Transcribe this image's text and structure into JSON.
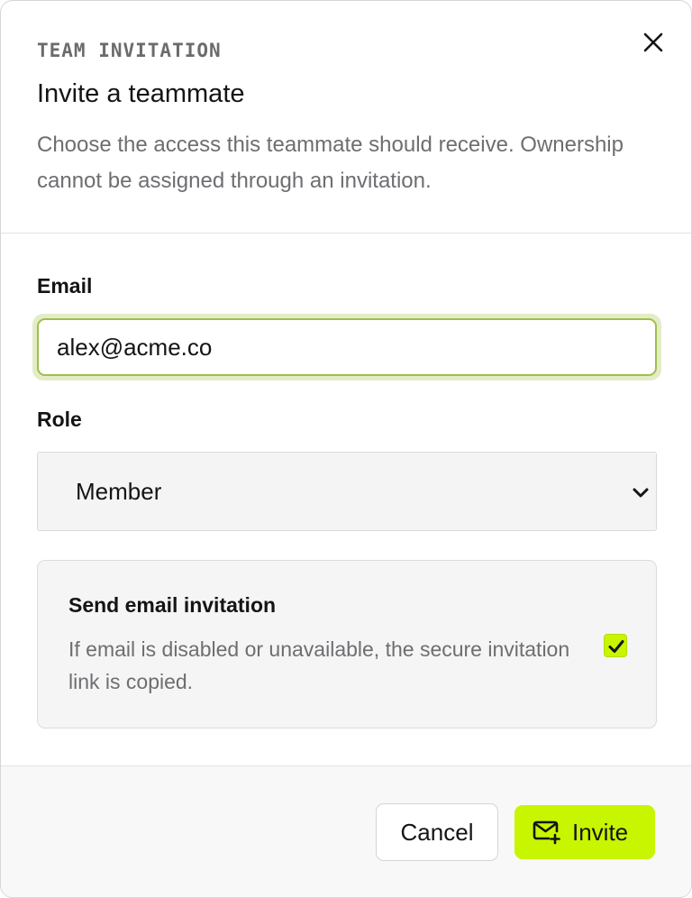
{
  "header": {
    "eyebrow": "TEAM INVITATION",
    "title": "Invite a teammate",
    "description": "Choose the access this teammate should receive. Ownership cannot be assigned through an invitation."
  },
  "form": {
    "email_label": "Email",
    "email_value": "alex@acme.co",
    "role_label": "Role",
    "role_value": "Member"
  },
  "notice": {
    "title": "Send email invitation",
    "description": "If email is disabled or unavailable, the secure invitation link is copied.",
    "checked": true
  },
  "footer": {
    "cancel_label": "Cancel",
    "invite_label": "Invite"
  },
  "icons": {
    "close": "close-icon",
    "chevron": "chevron-down-icon",
    "check": "check-icon",
    "mail_plus": "mail-plus-icon"
  },
  "colors": {
    "accent": "#c8f500",
    "focus_border": "#9ec04a",
    "focus_ring": "#e3ecc7",
    "muted_text": "#6e6e72"
  }
}
